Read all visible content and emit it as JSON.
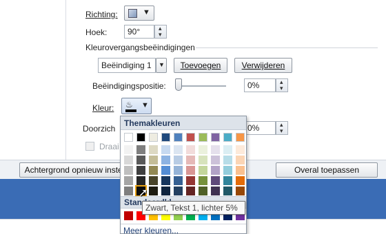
{
  "panel": {
    "richting_label": "Richting:",
    "hoek_label": "Hoek:",
    "hoek_value": "90°",
    "section_title": "Kleurovergangsbeëindigingen",
    "beeindiging_value": "Beëindiging 1",
    "toevoegen_label": "Toevoegen",
    "verwijderen_label": "Verwijderen",
    "positie_label": "Beëindigingspositie:",
    "positie_value": "0%",
    "positie_level": 0,
    "kleur_label": "Kleur:",
    "doorzichtigheid_label": "Doorzich",
    "doorzichtigheid_value": "0%",
    "draaien_label": "Draai"
  },
  "buttons": {
    "reset_label": "Achtergrond opnieuw instel",
    "apply_all_label": "Overal toepassen"
  },
  "color_picker": {
    "theme_header": "Themakleuren",
    "standard_header": "Standaardkl",
    "more_colors": "Meer kleuren...",
    "tooltip": "Zwart, Tekst 1, lichter 5%",
    "theme_top_row": [
      "#FFFFFF",
      "#000000",
      "#EEECE1",
      "#1F497D",
      "#4F81BD",
      "#C0504D",
      "#9BBB59",
      "#8064A2",
      "#4BACC6",
      "#F79646"
    ],
    "theme_shades": [
      [
        "#F2F2F2",
        "#7F7F7F",
        "#DDD9C3",
        "#C6D9F0",
        "#DBE5F1",
        "#F2DCDB",
        "#EBF1DD",
        "#E5E0EC",
        "#DBEEF3",
        "#FDEADA"
      ],
      [
        "#D8D8D8",
        "#595959",
        "#C4BD97",
        "#8DB3E2",
        "#B8CCE4",
        "#E5B9B7",
        "#D7E3BC",
        "#CCC1D9",
        "#B7DDE8",
        "#FBD5B5"
      ],
      [
        "#BFBFBF",
        "#3F3F3F",
        "#938953",
        "#548DD4",
        "#95B3D7",
        "#D99694",
        "#C3D69B",
        "#B2A2C7",
        "#92CDDC",
        "#FAC08F"
      ],
      [
        "#A5A5A5",
        "#262626",
        "#494429",
        "#17365D",
        "#366092",
        "#953734",
        "#76923C",
        "#5F497A",
        "#31859B",
        "#E36C09"
      ],
      [
        "#7F7F7F",
        "#0C0C0C",
        "#1D1B10",
        "#0F243E",
        "#244061",
        "#632423",
        "#4F6128",
        "#3F3151",
        "#205867",
        "#974806"
      ]
    ],
    "standard_colors": [
      "#C00000",
      "#FF0000",
      "#FFC000",
      "#FFFF00",
      "#92D050",
      "#00B050",
      "#00B0F0",
      "#0070C0",
      "#002060",
      "#7030A0"
    ]
  }
}
